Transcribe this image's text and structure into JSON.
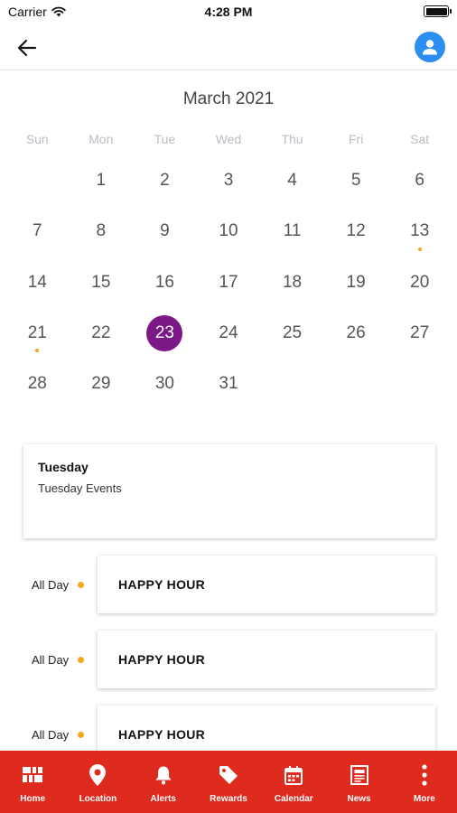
{
  "status_bar": {
    "carrier": "Carrier",
    "time": "4:28 PM"
  },
  "calendar": {
    "month_label": "March 2021",
    "weekdays": [
      "Sun",
      "Mon",
      "Tue",
      "Wed",
      "Thu",
      "Fri",
      "Sat"
    ],
    "first_weekday_offset": 1,
    "days_in_month": 31,
    "selected_day": 23,
    "event_days": [
      13,
      21
    ],
    "selected_color": "#7b1a87",
    "event_dot_color": "#f5a623"
  },
  "day_card": {
    "title": "Tuesday",
    "subtitle": "Tuesday Events"
  },
  "events": [
    {
      "time": "All Day",
      "title": "HAPPY HOUR"
    },
    {
      "time": "All Day",
      "title": "HAPPY HOUR"
    },
    {
      "time": "All Day",
      "title": "HAPPY HOUR"
    }
  ],
  "tab_bar": {
    "background": "#df2a1e",
    "tabs": [
      {
        "label": "Home",
        "icon": "grid-icon"
      },
      {
        "label": "Location",
        "icon": "location-pin-icon"
      },
      {
        "label": "Alerts",
        "icon": "bell-icon"
      },
      {
        "label": "Rewards",
        "icon": "tag-icon"
      },
      {
        "label": "Calendar",
        "icon": "calendar-icon"
      },
      {
        "label": "News",
        "icon": "newspaper-icon"
      },
      {
        "label": "More",
        "icon": "more-vertical-icon"
      }
    ]
  }
}
